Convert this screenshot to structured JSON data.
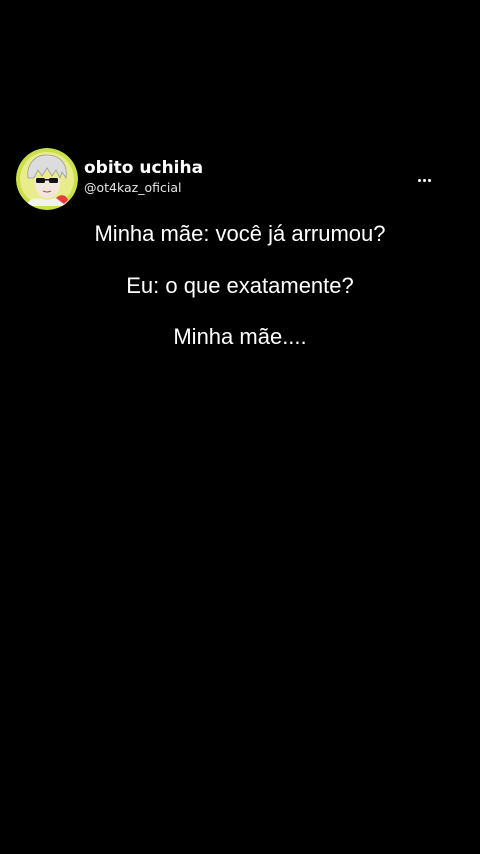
{
  "post": {
    "author": {
      "display_name": "obito uchiha",
      "handle": "@ot4kaz_oficial",
      "avatar_icon": "anime-avatar-icon"
    },
    "more_icon": "more-horizontal-icon",
    "lines": [
      "Minha mãe: você já arrumou?",
      "Eu: o que exatamente?",
      "Minha mãe...."
    ]
  },
  "colors": {
    "background": "#000000",
    "text": "#ffffff",
    "avatar_ring": "#c9e04a"
  }
}
